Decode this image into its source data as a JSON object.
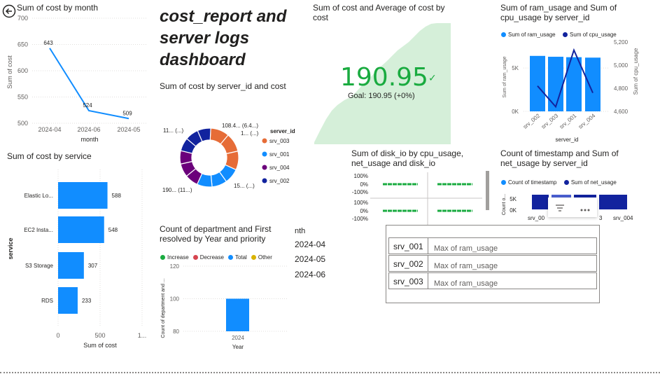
{
  "report_title": "cost_report and server logs dashboard",
  "back_icon": "back-arrow-icon",
  "visuals": {
    "cost_by_month": {
      "title": "Sum of cost by month",
      "xlabel": "month",
      "ylabel": "Sum of cost",
      "yticks": [
        "700",
        "650",
        "600",
        "550",
        "500"
      ],
      "xticks": [
        "2024-04",
        "2024-06",
        "2024-05"
      ],
      "data_labels": [
        "643",
        "524",
        "509"
      ]
    },
    "cost_by_service": {
      "title": "Sum of cost by service",
      "xlabel": "Sum of cost",
      "ylabel": "service",
      "xticks": [
        "0",
        "500",
        "1..."
      ],
      "categories": [
        "Elastic Lo...",
        "EC2 Insta...",
        "S3 Storage",
        "RDS"
      ],
      "data_labels": [
        "588",
        "548",
        "307",
        "233"
      ]
    },
    "cost_by_server": {
      "title": "Sum of cost by server_id and cost",
      "legend_title": "server_id",
      "legend": [
        "srv_003",
        "srv_001",
        "srv_004",
        "srv_002"
      ],
      "slice_labels": [
        "108.4... (6.4...)",
        "1... (...)",
        "15... (...)",
        "190... (11...)",
        "11... (...)"
      ]
    },
    "kpi": {
      "title": "Sum of cost and Average of cost by cost",
      "value": "190.95",
      "goal": "Goal: 190.95 (+0%)",
      "check_icon": "checkmark-icon"
    },
    "ram_cpu": {
      "title": "Sum of ram_usage and Sum of cpu_usage by server_id",
      "legend": [
        "Sum of ram_usage",
        "Sum of cpu_usage"
      ],
      "y_left_label": "Sum of ram_usage",
      "y_right_label": "Sum of cpu_usage",
      "y_left_ticks": [
        "5K",
        "0K"
      ],
      "y_right_ticks": [
        "5,200",
        "5,000",
        "4,800",
        "4,600"
      ],
      "x_label": "server_id",
      "categories": [
        "srv_002",
        "srv_003",
        "srv_001",
        "srv_004"
      ]
    },
    "disk_io": {
      "title": "Sum of disk_io by cpu_usage, net_usage and disk_io",
      "ticks_top": [
        "100%",
        "0%",
        "-100%"
      ],
      "ticks_bottom": [
        "100%",
        "0%",
        "-100%"
      ]
    },
    "timestamp_net": {
      "title": "Count of timestamp and Sum of net_usage by server_id",
      "legend": [
        "Count of timestamp",
        "Sum of net_usage"
      ],
      "y_label": "Count o...",
      "y_ticks": [
        "5K",
        "0K"
      ],
      "x_label": "server_id",
      "x_ticks": [
        "srv_00",
        "3",
        "srv_004"
      ],
      "filter_icon": "filter-icon",
      "more_icon": "more-options-icon"
    },
    "department": {
      "title": "Count of department and First resolved by Year and priority",
      "legend": [
        "Increase",
        "Decrease",
        "Total",
        "Other"
      ],
      "y_label": "Count of department and ...",
      "y_ticks": [
        "120",
        "100",
        "80"
      ],
      "x_tick": "2024",
      "x_label": "Year"
    },
    "month_slicer": {
      "header": "nth",
      "items": [
        "2024-04",
        "2024-05",
        "2024-06"
      ]
    },
    "ram_table": {
      "rows": [
        {
          "server": "srv_001",
          "metric": "Max of ram_usage"
        },
        {
          "server": "srv_002",
          "metric": "Max of ram_usage"
        },
        {
          "server": "srv_003",
          "metric": "Max of ram_usage"
        }
      ]
    }
  },
  "colors": {
    "primary_blue": "#118DFF",
    "dark_blue": "#12239E",
    "orange": "#E66C37",
    "purple": "#6B007B",
    "kpi_green": "#1AAB40",
    "kpi_area": "#D5EFD9",
    "other_yellow": "#D9B300"
  },
  "chart_data": [
    {
      "type": "line",
      "title": "Sum of cost by month",
      "x": [
        "2024-04",
        "2024-06",
        "2024-05"
      ],
      "series": [
        {
          "values": [
            643,
            524,
            509
          ]
        }
      ],
      "xlabel": "month",
      "ylabel": "Sum of cost",
      "ylim": [
        500,
        700
      ]
    },
    {
      "type": "bar",
      "title": "Sum of cost by service",
      "categories": [
        "Elastic Lo...",
        "EC2 Insta...",
        "S3 Storage",
        "RDS"
      ],
      "values": [
        588,
        548,
        307,
        233
      ],
      "xlabel": "Sum of cost",
      "ylabel": "service",
      "xlim": [
        0,
        1000
      ]
    },
    {
      "type": "pie",
      "title": "Sum of cost by server_id and cost",
      "categories": [
        "srv_003",
        "srv_001",
        "srv_004",
        "srv_002"
      ],
      "values": [
        31,
        25,
        22,
        22
      ]
    },
    {
      "type": "bar",
      "title": "Sum of ram_usage and Sum of cpu_usage by server_id",
      "categories": [
        "srv_002",
        "srv_003",
        "srv_001",
        "srv_004"
      ],
      "series": [
        {
          "name": "Sum of ram_usage",
          "values": [
            6400,
            6300,
            6250,
            6200
          ]
        },
        {
          "name": "Sum of cpu_usage",
          "values": [
            4820,
            4640,
            5130,
            4760
          ]
        }
      ],
      "ylim_left": [
        0,
        8000
      ],
      "ylim_right": [
        4600,
        5200
      ]
    },
    {
      "type": "bar",
      "title": "Count of department and First resolved by Year and priority",
      "categories": [
        "2024"
      ],
      "values": [
        100
      ],
      "ylim": [
        80,
        120
      ]
    }
  ]
}
